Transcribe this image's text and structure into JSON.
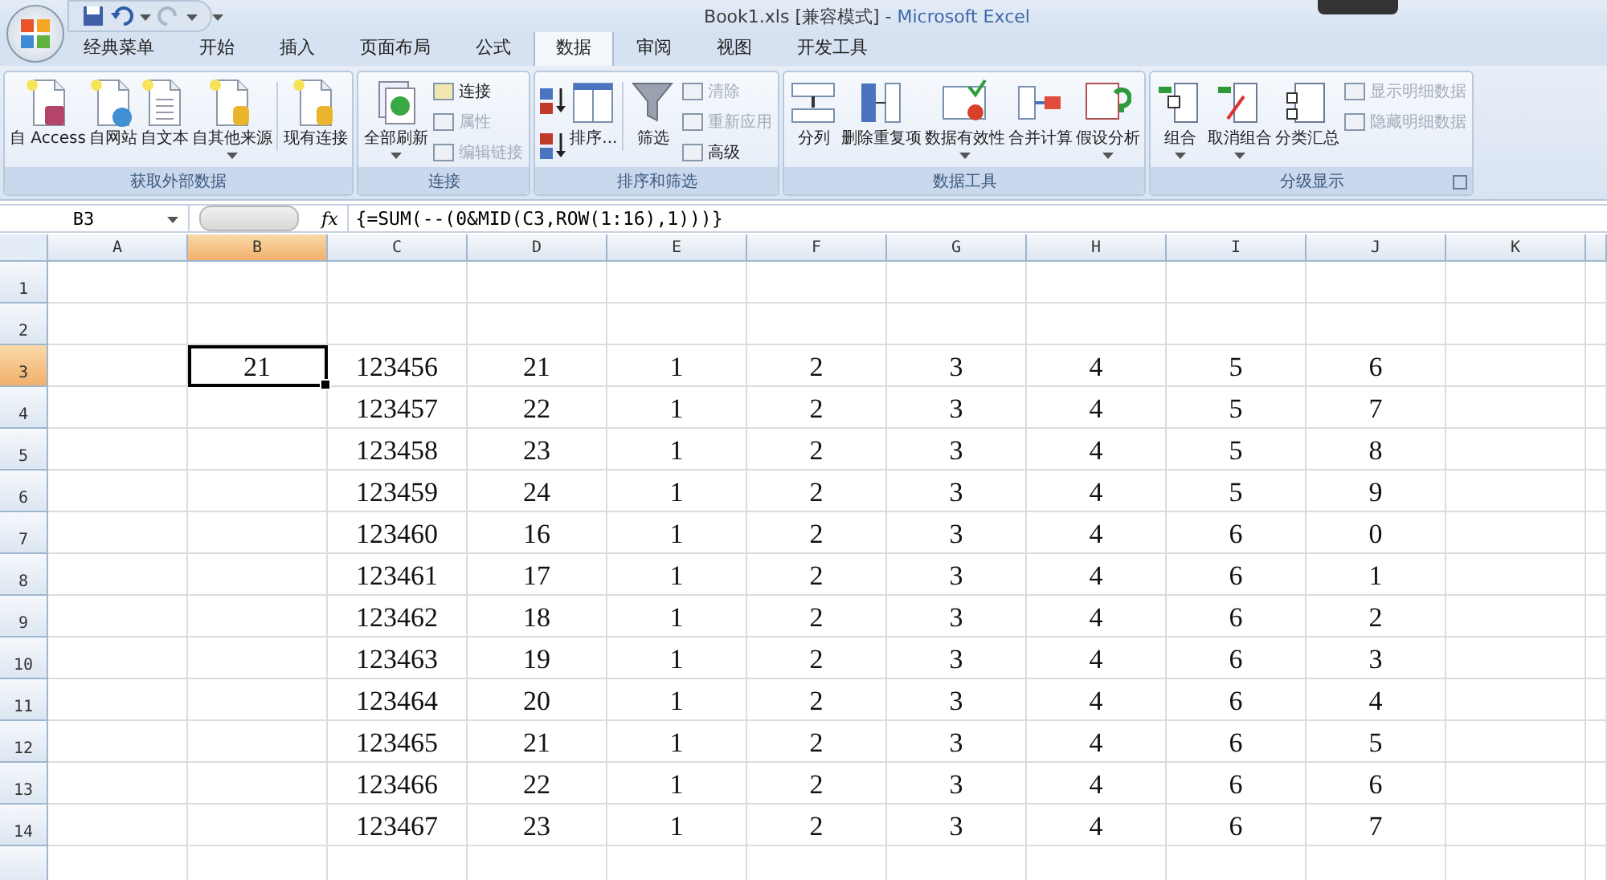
{
  "window": {
    "title": "Book1.xls  [兼容模式] - ",
    "app_name": "Microsoft Excel"
  },
  "tabs": [
    {
      "label": "经典菜单",
      "selected": false
    },
    {
      "label": "开始",
      "selected": false
    },
    {
      "label": "插入",
      "selected": false
    },
    {
      "label": "页面布局",
      "selected": false
    },
    {
      "label": "公式",
      "selected": false
    },
    {
      "label": "数据",
      "selected": true
    },
    {
      "label": "审阅",
      "selected": false
    },
    {
      "label": "视图",
      "selected": false
    },
    {
      "label": "开发工具",
      "selected": false
    }
  ],
  "ribbon_groups": [
    {
      "title": "获取外部数据",
      "launcher": false,
      "buttons": [
        {
          "kind": "large",
          "label": "自 Access",
          "dropdown": false,
          "disabled": false
        },
        {
          "kind": "large",
          "label": "自网站",
          "dropdown": false,
          "disabled": false
        },
        {
          "kind": "large",
          "label": "自文本",
          "dropdown": false,
          "disabled": false
        },
        {
          "kind": "large",
          "label": "自其他来源",
          "dropdown": true,
          "disabled": false
        },
        {
          "kind": "separator"
        },
        {
          "kind": "large",
          "label": "现有连接",
          "dropdown": false,
          "disabled": false
        }
      ]
    },
    {
      "title": "连接",
      "launcher": false,
      "buttons": [
        {
          "kind": "large",
          "label": "全部刷新",
          "dropdown": true,
          "disabled": false
        },
        {
          "kind": "stack",
          "items": [
            {
              "label": "连接",
              "disabled": false
            },
            {
              "label": "属性",
              "disabled": true
            },
            {
              "label": "编辑链接",
              "disabled": true
            }
          ]
        }
      ]
    },
    {
      "title": "排序和筛选",
      "launcher": false,
      "buttons": [
        {
          "kind": "sort_pair"
        },
        {
          "kind": "large",
          "label": "排序...",
          "dropdown": false,
          "disabled": false
        },
        {
          "kind": "separator"
        },
        {
          "kind": "large",
          "label": "筛选",
          "dropdown": false,
          "disabled": false
        },
        {
          "kind": "stack",
          "items": [
            {
              "label": "清除",
              "disabled": true
            },
            {
              "label": "重新应用",
              "disabled": true
            },
            {
              "label": "高级",
              "disabled": false
            }
          ]
        }
      ]
    },
    {
      "title": "数据工具",
      "launcher": false,
      "buttons": [
        {
          "kind": "large",
          "label": "分列",
          "dropdown": false,
          "disabled": false
        },
        {
          "kind": "large",
          "label": "删除重复项",
          "dropdown": false,
          "disabled": false
        },
        {
          "kind": "large",
          "label": "数据有效性",
          "dropdown": true,
          "disabled": false
        },
        {
          "kind": "large",
          "label": "合并计算",
          "dropdown": false,
          "disabled": false
        },
        {
          "kind": "large",
          "label": "假设分析",
          "dropdown": true,
          "disabled": false
        }
      ]
    },
    {
      "title": "分级显示",
      "launcher": true,
      "buttons": [
        {
          "kind": "large",
          "label": "组合",
          "dropdown": true,
          "disabled": false
        },
        {
          "kind": "large",
          "label": "取消组合",
          "dropdown": true,
          "disabled": false
        },
        {
          "kind": "large",
          "label": "分类汇总",
          "dropdown": false,
          "disabled": false
        },
        {
          "kind": "stack",
          "items": [
            {
              "label": "显示明细数据",
              "disabled": true
            },
            {
              "label": "隐藏明细数据",
              "disabled": true
            }
          ]
        }
      ]
    }
  ],
  "formula_bar": {
    "name_box": "B3",
    "function_label": "fx",
    "formula": "{=SUM(--(0&MID(C3,ROW(1:16),1)))}"
  },
  "sheet": {
    "columns": [
      {
        "label": "A",
        "selected": false
      },
      {
        "label": "B",
        "selected": true
      },
      {
        "label": "C",
        "selected": false
      },
      {
        "label": "D",
        "selected": false
      },
      {
        "label": "E",
        "selected": false
      },
      {
        "label": "F",
        "selected": false
      },
      {
        "label": "G",
        "selected": false
      },
      {
        "label": "H",
        "selected": false
      },
      {
        "label": "I",
        "selected": false
      },
      {
        "label": "J",
        "selected": false
      },
      {
        "label": "K",
        "selected": false
      }
    ],
    "rows": [
      {
        "number": "1",
        "selected": false,
        "cells": [
          null,
          null,
          null,
          null,
          null,
          null,
          null,
          null,
          null,
          null,
          null
        ]
      },
      {
        "number": "2",
        "selected": false,
        "cells": [
          null,
          null,
          null,
          null,
          null,
          null,
          null,
          null,
          null,
          null,
          null
        ]
      },
      {
        "number": "3",
        "selected": true,
        "cells": [
          null,
          {
            "value": "21",
            "active": true
          },
          {
            "value": "123456"
          },
          {
            "value": "21"
          },
          {
            "value": "1"
          },
          {
            "value": "2"
          },
          {
            "value": "3"
          },
          {
            "value": "4"
          },
          {
            "value": "5"
          },
          {
            "value": "6"
          },
          null
        ]
      },
      {
        "number": "4",
        "selected": false,
        "cells": [
          null,
          null,
          {
            "value": "123457"
          },
          {
            "value": "22"
          },
          {
            "value": "1"
          },
          {
            "value": "2"
          },
          {
            "value": "3"
          },
          {
            "value": "4"
          },
          {
            "value": "5"
          },
          {
            "value": "7"
          },
          null
        ]
      },
      {
        "number": "5",
        "selected": false,
        "cells": [
          null,
          null,
          {
            "value": "123458"
          },
          {
            "value": "23"
          },
          {
            "value": "1"
          },
          {
            "value": "2"
          },
          {
            "value": "3"
          },
          {
            "value": "4"
          },
          {
            "value": "5"
          },
          {
            "value": "8"
          },
          null
        ]
      },
      {
        "number": "6",
        "selected": false,
        "cells": [
          null,
          null,
          {
            "value": "123459"
          },
          {
            "value": "24"
          },
          {
            "value": "1"
          },
          {
            "value": "2"
          },
          {
            "value": "3"
          },
          {
            "value": "4"
          },
          {
            "value": "5"
          },
          {
            "value": "9"
          },
          null
        ]
      },
      {
        "number": "7",
        "selected": false,
        "cells": [
          null,
          null,
          {
            "value": "123460"
          },
          {
            "value": "16"
          },
          {
            "value": "1"
          },
          {
            "value": "2"
          },
          {
            "value": "3"
          },
          {
            "value": "4"
          },
          {
            "value": "6"
          },
          {
            "value": "0"
          },
          null
        ]
      },
      {
        "number": "8",
        "selected": false,
        "cells": [
          null,
          null,
          {
            "value": "123461"
          },
          {
            "value": "17"
          },
          {
            "value": "1"
          },
          {
            "value": "2"
          },
          {
            "value": "3"
          },
          {
            "value": "4"
          },
          {
            "value": "6"
          },
          {
            "value": "1"
          },
          null
        ]
      },
      {
        "number": "9",
        "selected": false,
        "cells": [
          null,
          null,
          {
            "value": "123462"
          },
          {
            "value": "18"
          },
          {
            "value": "1"
          },
          {
            "value": "2"
          },
          {
            "value": "3"
          },
          {
            "value": "4"
          },
          {
            "value": "6"
          },
          {
            "value": "2"
          },
          null
        ]
      },
      {
        "number": "10",
        "selected": false,
        "cells": [
          null,
          null,
          {
            "value": "123463"
          },
          {
            "value": "19"
          },
          {
            "value": "1"
          },
          {
            "value": "2"
          },
          {
            "value": "3"
          },
          {
            "value": "4"
          },
          {
            "value": "6"
          },
          {
            "value": "3"
          },
          null
        ]
      },
      {
        "number": "11",
        "selected": false,
        "cells": [
          null,
          null,
          {
            "value": "123464"
          },
          {
            "value": "20"
          },
          {
            "value": "1"
          },
          {
            "value": "2"
          },
          {
            "value": "3"
          },
          {
            "value": "4"
          },
          {
            "value": "6"
          },
          {
            "value": "4"
          },
          null
        ]
      },
      {
        "number": "12",
        "selected": false,
        "cells": [
          null,
          null,
          {
            "value": "123465"
          },
          {
            "value": "21"
          },
          {
            "value": "1"
          },
          {
            "value": "2"
          },
          {
            "value": "3"
          },
          {
            "value": "4"
          },
          {
            "value": "6"
          },
          {
            "value": "5"
          },
          null
        ]
      },
      {
        "number": "13",
        "selected": false,
        "cells": [
          null,
          null,
          {
            "value": "123466"
          },
          {
            "value": "22"
          },
          {
            "value": "1"
          },
          {
            "value": "2"
          },
          {
            "value": "3"
          },
          {
            "value": "4"
          },
          {
            "value": "6"
          },
          {
            "value": "6"
          },
          null
        ]
      },
      {
        "number": "14",
        "selected": false,
        "cells": [
          null,
          null,
          {
            "value": "123467"
          },
          {
            "value": "23"
          },
          {
            "value": "1"
          },
          {
            "value": "2"
          },
          {
            "value": "3"
          },
          {
            "value": "4"
          },
          {
            "value": "6"
          },
          {
            "value": "7"
          },
          null
        ]
      }
    ]
  }
}
